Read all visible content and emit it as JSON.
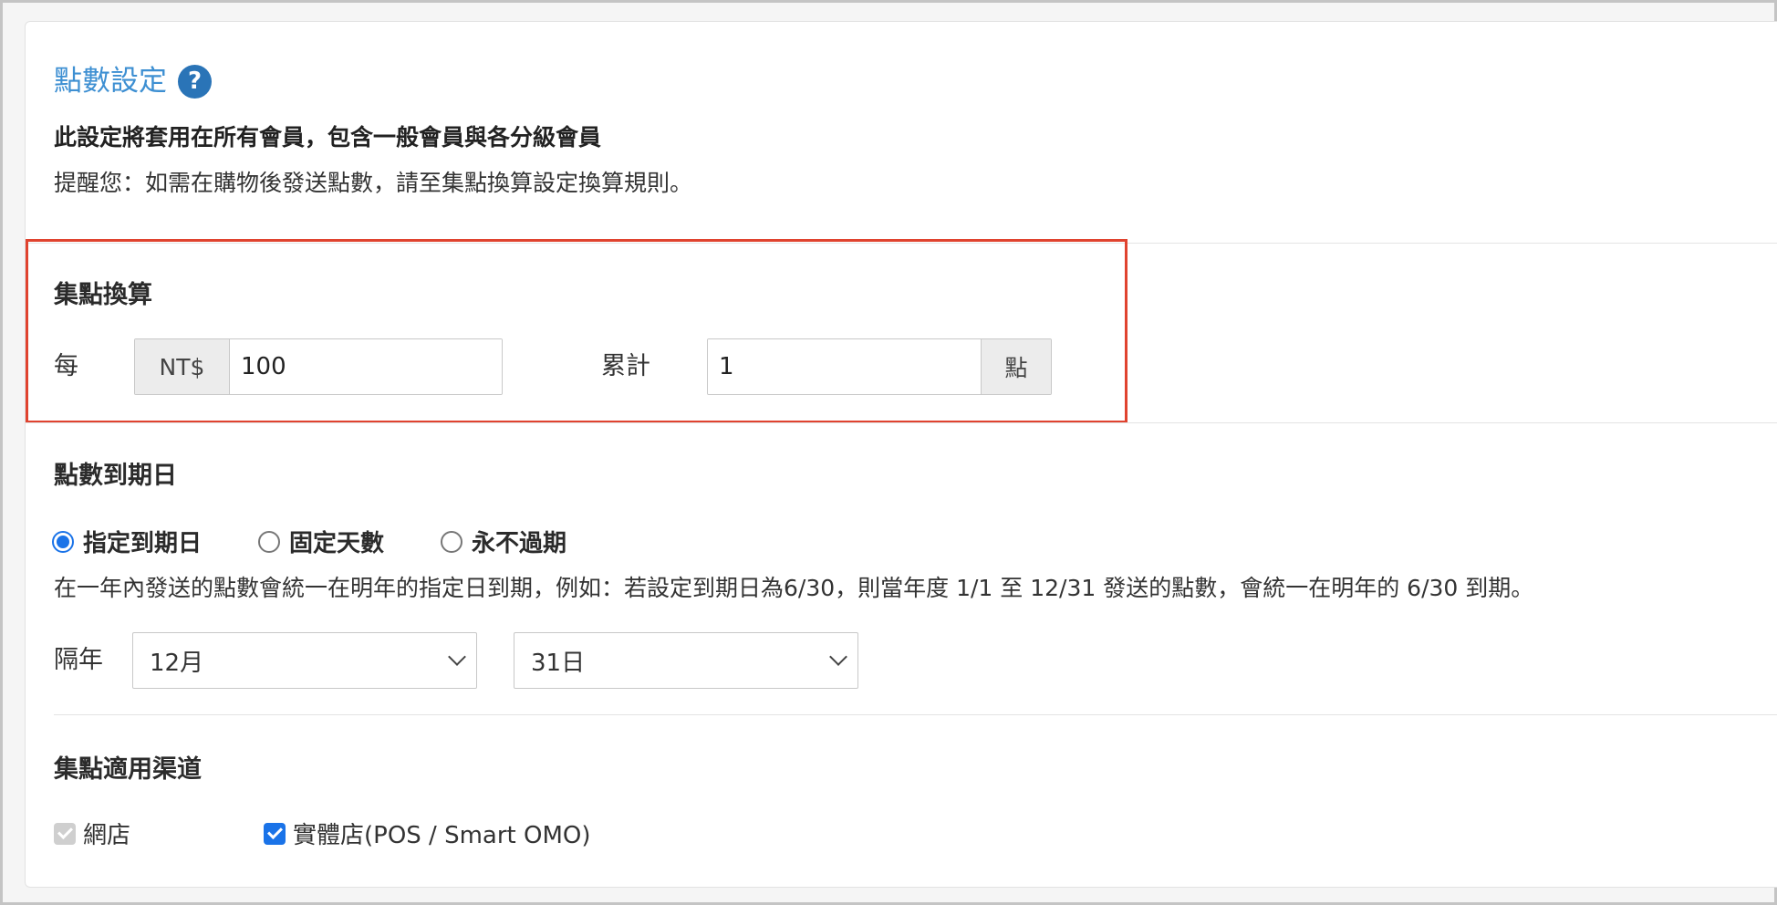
{
  "header": {
    "title": "點數設定",
    "help_icon": "question-circle-icon",
    "description_bold": "此設定將套用在所有會員，包含一般會員與各分級會員",
    "description": "提醒您：如需在購物後發送點數，請至集點換算設定換算規則。"
  },
  "conversion": {
    "section_title": "集點換算",
    "every_label": "每",
    "currency_addon": "NT$",
    "amount_value": "100",
    "accumulate_label": "累計",
    "points_value": "1",
    "points_addon": "點"
  },
  "expiry": {
    "section_title": "點數到期日",
    "options": [
      "指定到期日",
      "固定天數",
      "永不過期"
    ],
    "selected_option": "指定到期日",
    "note": "在一年內發送的點數會統一在明年的指定日到期，例如：若設定到期日為6/30，則當年度 1/1 至 12/31 發送的點數，會統一在明年的 6/30 到期。",
    "next_year_label": "隔年",
    "month_value": "12月",
    "day_value": "31日"
  },
  "channels": {
    "section_title": "集點適用渠道",
    "online_store": "網店",
    "online_store_checked": true,
    "online_store_disabled": true,
    "physical_store": "實體店(POS / Smart OMO)",
    "physical_store_checked": true
  },
  "colors": {
    "title": "#3d8fd2",
    "help_icon": "#2a74b7",
    "highlight_border": "#e0432f",
    "accent": "#1a73e8"
  }
}
